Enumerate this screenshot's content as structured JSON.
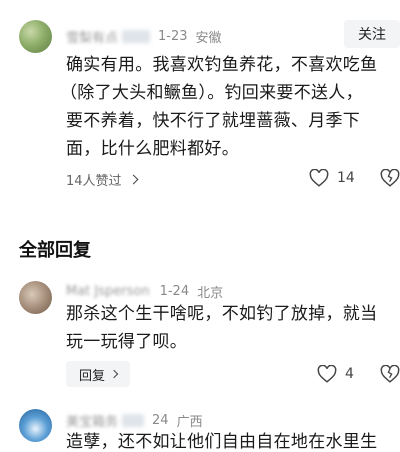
{
  "comments": [
    {
      "username": "雪梨有点",
      "date": "1-23",
      "location": "安徽",
      "follow_label": "关注",
      "text_lines": [
        "确实有用。我喜欢钓鱼养花，不喜欢吃鱼",
        "（除了大头和鳜鱼）。钓回来要不送人，",
        "要不养着，快不行了就埋蔷薇、月季下",
        "面，比什么肥料都好。"
      ],
      "liked_by": "14人赞过",
      "likes": "14",
      "icons": [
        "chevron-right-icon",
        "heart-icon",
        "dislike-icon"
      ]
    }
  ],
  "section_title": "全部回复",
  "replies": [
    {
      "username": "Mat   Jsperson",
      "date": "1-24",
      "location": "北京",
      "text_lines": [
        "那杀这个生干啥呢，不如钓了放掉，就当",
        "玩一玩得了呗。"
      ],
      "reply_label": "回复",
      "likes": "4"
    },
    {
      "username": "美宝箱务",
      "date": "24",
      "location": "广西",
      "text_lines": [
        "造孽，还不如让他们自由自在地在水里生"
      ]
    }
  ]
}
